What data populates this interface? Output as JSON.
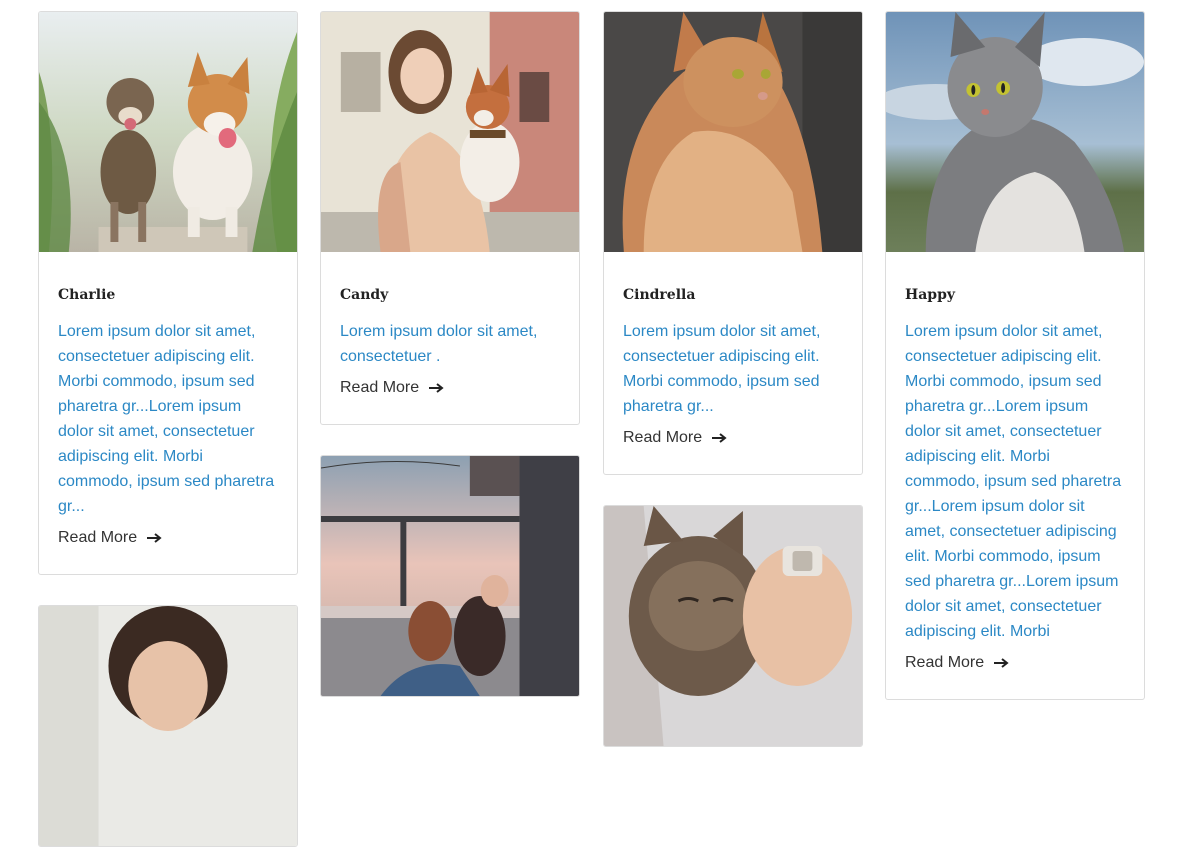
{
  "cards": [
    {
      "title": "Charlie",
      "image": "two-dogs-running-photo",
      "description": "Lorem ipsum dolor sit amet, consectetuer adipiscing elit. Morbi commodo, ipsum sed pharetra gr...Lorem ipsum dolor sit amet, consectetuer adipiscing elit. Morbi commodo, ipsum sed pharetra gr...",
      "read_more": "Read More"
    },
    {
      "title": "Candy",
      "image": "woman-holding-dog-photo",
      "description": "Lorem ipsum dolor sit amet, consectetuer .",
      "read_more": "Read More"
    },
    {
      "title": "Cindrella",
      "image": "orange-cat-photo",
      "description": "Lorem ipsum dolor sit amet, consectetuer adipiscing elit. Morbi commodo, ipsum sed pharetra gr...",
      "read_more": "Read More"
    },
    {
      "title": "Happy",
      "image": "grey-cat-photo",
      "description": "Lorem ipsum dolor sit amet, consectetuer adipiscing elit. Morbi commodo, ipsum sed pharetra gr...Lorem ipsum dolor sit amet, consectetuer adipiscing elit. Morbi commodo, ipsum sed pharetra gr...Lorem ipsum dolor sit amet, consectetuer adipiscing elit. Morbi commodo, ipsum sed pharetra gr...Lorem ipsum dolor sit amet, consectetuer adipiscing elit. Morbi",
      "read_more": "Read More"
    }
  ],
  "partial_cards": [
    {
      "image": "woman-portrait-photo"
    },
    {
      "image": "woman-kissing-dog-photo"
    },
    {
      "image": "tabby-cat-in-arms-photo"
    }
  ],
  "colors": {
    "link": "#2b88c5",
    "text": "#333333",
    "border": "#dcdcdc"
  }
}
